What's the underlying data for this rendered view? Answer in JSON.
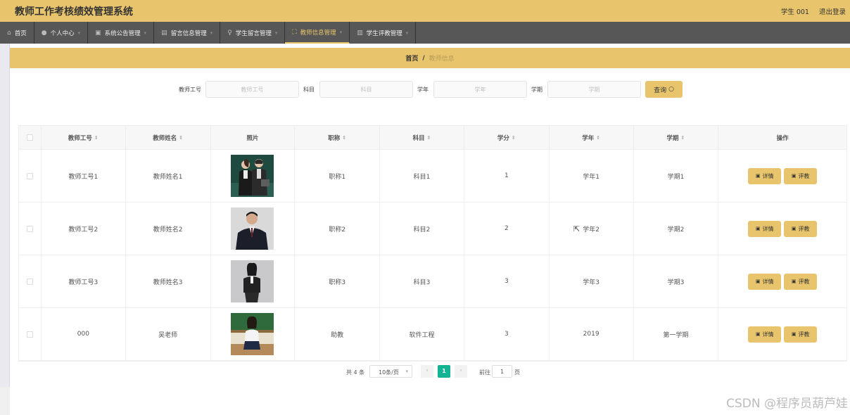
{
  "header": {
    "title": "教师工作考核绩效管理系统",
    "user": "学生 001",
    "logout": "退出登录"
  },
  "nav": [
    {
      "label": "首页",
      "icon": "home-icon"
    },
    {
      "label": "个人中心",
      "icon": "user-icon"
    },
    {
      "label": "系统公告管理",
      "icon": "notice-icon"
    },
    {
      "label": "留言信息管理",
      "icon": "message-icon"
    },
    {
      "label": "学生留言管理",
      "icon": "mic-icon"
    },
    {
      "label": "教师信息管理",
      "icon": "expand-icon",
      "active": true
    },
    {
      "label": "学生评教管理",
      "icon": "chart-icon"
    }
  ],
  "breadcrumb": {
    "home": "首页",
    "separator": "/",
    "current": "教师信息"
  },
  "search": {
    "fields": [
      {
        "label": "教师工号",
        "placeholder": "教师工号"
      },
      {
        "label": "科目",
        "placeholder": "科目"
      },
      {
        "label": "学年",
        "placeholder": "学年"
      },
      {
        "label": "学期",
        "placeholder": "学期"
      }
    ],
    "button": "查询"
  },
  "table": {
    "headers": [
      "教师工号",
      "教师姓名",
      "照片",
      "职称",
      "科目",
      "学分",
      "学年",
      "学期",
      "操作"
    ],
    "rows": [
      {
        "id": "教师工号1",
        "name": "教师姓名1",
        "title": "职称1",
        "subject": "科目1",
        "credit": "1",
        "year": "学年1",
        "term": "学期1",
        "photo": "photo-two-people-icon"
      },
      {
        "id": "教师工号2",
        "name": "教师姓名2",
        "title": "职称2",
        "subject": "科目2",
        "credit": "2",
        "year": "学年2",
        "term": "学期2",
        "photo": "photo-man-suit-icon"
      },
      {
        "id": "教师工号3",
        "name": "教师姓名3",
        "title": "职称3",
        "subject": "科目3",
        "credit": "3",
        "year": "学年3",
        "term": "学期3",
        "photo": "photo-woman-suit-icon"
      },
      {
        "id": "000",
        "name": "吴老师",
        "title": "助教",
        "subject": "软件工程",
        "credit": "3",
        "year": "2019",
        "term": "第一学期",
        "photo": "photo-teacher-classroom-icon"
      }
    ],
    "actions": {
      "detail": "详情",
      "evaluate": "评教"
    }
  },
  "pagination": {
    "total": "共 4 条",
    "page_size": "10条/页",
    "current": "1",
    "goto_label": "前往",
    "goto_value": "1",
    "page_suffix": "页"
  },
  "watermark": "CSDN @程序员葫芦娃",
  "colors": {
    "accent": "#e8c56c",
    "nav_bg": "#575757",
    "pager_active": "#13b394"
  }
}
